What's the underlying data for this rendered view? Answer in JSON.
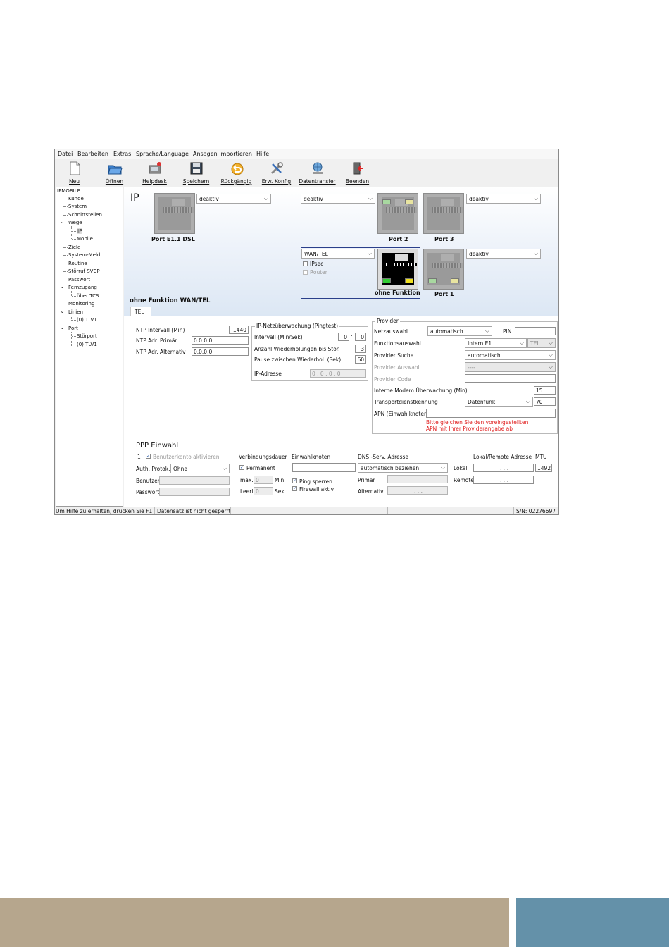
{
  "menu": [
    "Datei",
    "Bearbeiten",
    "Extras",
    "Sprache/Language",
    "Ansagen importieren",
    "Hilfe"
  ],
  "toolbar": [
    {
      "label": "Neu",
      "icon": "document-icon"
    },
    {
      "label": "Öffnen",
      "icon": "folder-open-icon"
    },
    {
      "label": "Helpdesk",
      "icon": "helpdesk-icon"
    },
    {
      "label": "Speichern",
      "icon": "floppy-disk-icon"
    },
    {
      "label": "Rückgängig",
      "icon": "undo-icon"
    },
    {
      "label": "Erw. Konfig",
      "icon": "tools-icon"
    },
    {
      "label": "Datentransfer",
      "icon": "data-transfer-icon"
    },
    {
      "label": "Beenden",
      "icon": "exit-icon"
    }
  ],
  "tree": {
    "root": "IPMOBILE",
    "items": [
      "Kunde",
      "System",
      "Schnittstellen",
      "Wege",
      "IP",
      "Mobile",
      "Ziele",
      "System-Meld.",
      "Routine",
      "Störruf SVCP",
      "Passwort",
      "Fernzugang",
      "über TCS",
      "Monitoring",
      "Linien",
      "(0) TLV1",
      "Port",
      "Störport",
      "(0) TLV1"
    ]
  },
  "page": {
    "title": "IP",
    "section_title": "ohne Funktion WAN/TEL",
    "tab": "TEL"
  },
  "ports": {
    "dsl": {
      "label": "Port E1.1 DSL",
      "select": "deaktiv"
    },
    "port2": {
      "label": "Port 2"
    },
    "port3": {
      "label": "Port 3",
      "select": "deaktiv"
    },
    "port23_select": "deaktiv",
    "wan": {
      "label": "ohne Funktion",
      "select": "WAN/TEL",
      "ipsec": "IPsec",
      "router": "Router"
    },
    "port1": {
      "label": "Port 1",
      "select": "deaktiv"
    },
    "colors": {
      "led_green": "#33cc33",
      "led_yellow": "#f0e020",
      "led_off_green": "#a8d8a0",
      "led_off_yellow": "#e8e4a0"
    }
  },
  "ntp": {
    "interval_label": "NTP Intervall (Min)",
    "interval_value": "1440",
    "primary_label": "NTP Adr. Primär",
    "primary_value": "0.0.0.0",
    "alt_label": "NTP Adr. Alternativ",
    "alt_value": "0.0.0.0"
  },
  "ping": {
    "legend": "IP-Netzüberwachung (Pingtest)",
    "interval_label": "Intervall (Min/Sek)",
    "interval_min": "0",
    "interval_sek": "0",
    "retries_label": "Anzahl Wiederholungen bis Stör.",
    "retries_value": "3",
    "pause_label": "Pause zwischen Wiederhol. (Sek)",
    "pause_value": "60",
    "ip_label": "IP-Adresse",
    "ip_value": "0 . 0 . 0 . 0"
  },
  "provider": {
    "legend": "Provider",
    "netz_label": "Netzauswahl",
    "netz_value": "automatisch",
    "pin_label": "PIN",
    "funktion_label": "Funktionsauswahl",
    "funktion_value": "Intern E1",
    "funktion_value2": "TEL",
    "suche_label": "Provider Suche",
    "suche_value": "automatisch",
    "auswahl_label": "Provider Auswahl",
    "auswahl_value": "----",
    "code_label": "Provider Code",
    "modem_label": "Interne Modem Überwachung (Min)",
    "modem_value": "15",
    "transport_label": "Transportdienstkennung",
    "transport_value": "Datenfunk",
    "transport_num": "70",
    "apn_label": "APN (Einwahlknoten)",
    "warning_1": "Bitte gleichen Sie den voreingestellten",
    "warning_2": "APN mit Ihrer Providerangabe ab"
  },
  "ppp": {
    "title": "PPP Einwahl",
    "row_index": "1",
    "account_label": "Benutzerkonto aktivieren",
    "auth_label": "Auth. Protok.",
    "auth_value": "Ohne",
    "user_label": "Benutzer",
    "pass_label": "Passwort",
    "dauer_label": "Verbindungsdauer",
    "permanent_label": "Permanent",
    "max_label": "max.",
    "max_value": "0",
    "max_unit": "Min",
    "leer_label": "Leerl.",
    "leer_value": "0",
    "leer_unit": "Sek",
    "knoten_label": "Einwahlknoten",
    "ping_label": "Ping sperren",
    "firewall_label": "Firewall aktiv",
    "dns_label": "DNS -Serv. Adresse",
    "dns_value": "automatisch beziehen",
    "primaer_label": "Primär",
    "alternativ_label": "Alternativ",
    "lr_label": "Lokal/Remote Adresse",
    "lokal_label": "Lokal",
    "remote_label": "Remote",
    "mtu_label": "MTU",
    "mtu_value": "1492",
    "ip_dots": ". . ."
  },
  "status": {
    "help": "Um Hilfe zu erhalten, drücken Sie F1",
    "record": "Datensatz ist nicht gesperrt",
    "serial": "S/N: 02276697"
  },
  "colors": {
    "footer_left": "#b6a68d",
    "footer_right": "#6491a9",
    "warning_red": "#e02020"
  }
}
